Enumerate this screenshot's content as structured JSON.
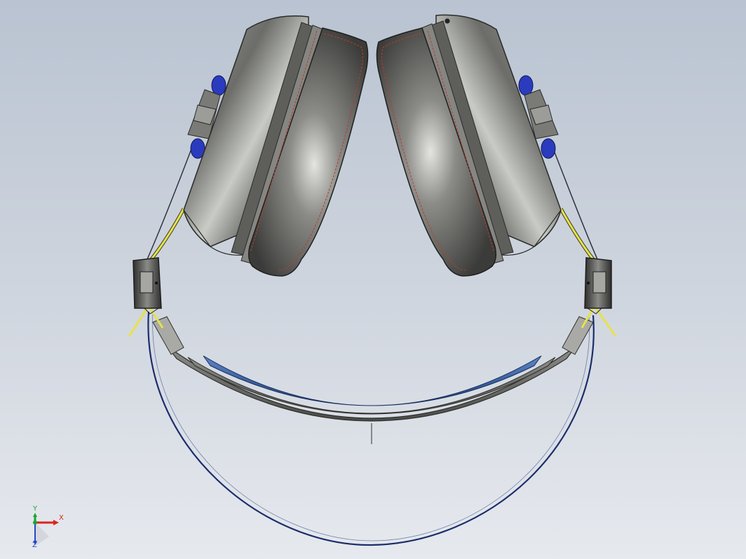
{
  "viewport": {
    "background_top": "#b9c3d1",
    "background_bottom": "#e6e9ee",
    "model": "headphones-assembly"
  },
  "colors": {
    "earcup_shell": "#6b6b68",
    "earcup_highlight": "#d9dbd6",
    "cushion": "#4e4f4c",
    "stitch": "#c0392b",
    "headband_outer": "#6f706b",
    "headband_inner": "#2f5b9e",
    "cable_yellow": "#e6e24a",
    "cable_blue": "#1c2d6b",
    "hinge_dark": "#3a3a38",
    "pivot_blue": "#2a3bbd"
  },
  "triad": {
    "x_label": "X",
    "y_label": "Y",
    "z_label": "Z",
    "x_color": "#d9261c",
    "y_color": "#1aa531",
    "z_color": "#2846c8"
  }
}
